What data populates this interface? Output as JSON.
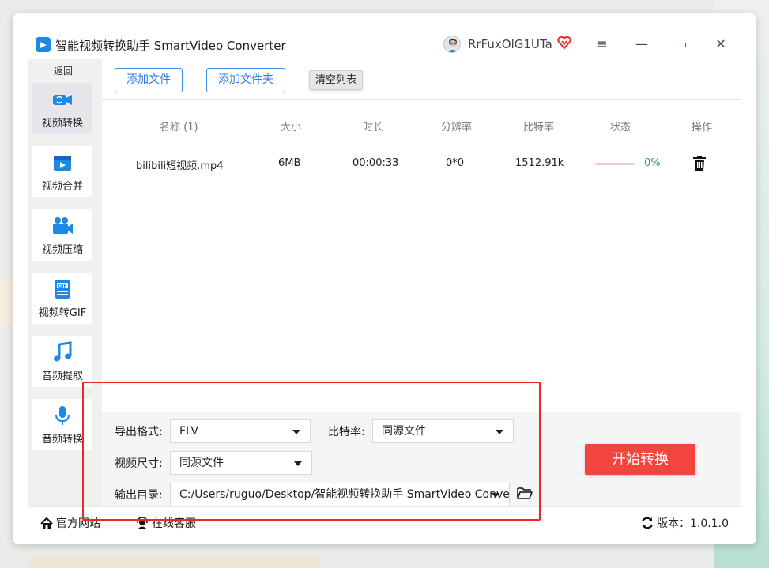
{
  "window": {
    "title": "智能视频转换助手 SmartVideo Converter",
    "logo_glyph": "▶",
    "user_name": "RrFuxOlG1UTa",
    "icons": [
      "app-logo-icon",
      "avatar-icon",
      "vip-heart-icon",
      "menu-icon",
      "minimize-icon",
      "maximize-icon",
      "close-icon"
    ],
    "controls": {
      "menu": "≡",
      "minimize": "—",
      "maximize": "▭",
      "close": "✕"
    }
  },
  "sidebar": {
    "back_label": "返回",
    "items": [
      {
        "label": "视频转换",
        "icon": "video-convert-icon",
        "active": true
      },
      {
        "label": "视频合并",
        "icon": "video-merge-icon",
        "active": false
      },
      {
        "label": "视频压缩",
        "icon": "video-compress-icon",
        "active": false
      },
      {
        "label": "视频转GIF",
        "icon": "gif-icon",
        "active": false
      },
      {
        "label": "音频提取",
        "icon": "music-note-icon",
        "active": false
      },
      {
        "label": "音频转换",
        "icon": "microphone-icon",
        "active": false
      }
    ],
    "accent_color": "#1e88e5"
  },
  "toolbar": {
    "add_file": "添加文件",
    "add_folder": "添加文件夹",
    "clear_list": "清空列表"
  },
  "file_table": {
    "columns": [
      "名称 (1)",
      "大小",
      "时长",
      "分辨率",
      "比特率",
      "状态",
      "操作"
    ],
    "rows": [
      {
        "name": "bilibili短视频.mp4",
        "size": "6MB",
        "duration": "00:00:33",
        "resolution": "0*0",
        "bitrate": "1512.91k",
        "progress": 0,
        "progress_text": "0%",
        "action_icon": "trash-icon"
      }
    ]
  },
  "settings": {
    "format_label": "导出格式:",
    "format_value": "FLV",
    "bitrate_label": "比特率:",
    "bitrate_value": "同源文件",
    "size_label": "视频尺寸:",
    "size_value": "同源文件",
    "output_label": "输出目录:",
    "output_value": "C:/Users/ruguo/Desktop/智能视频转换助手 SmartVideo Converter",
    "folder_icon": "folder-open-icon",
    "start_button": "开始转换",
    "start_color": "#f1453d"
  },
  "footer": {
    "website": "官方网站",
    "support": "在线客服",
    "version": "版本：1.0.1.0"
  },
  "annotation": {
    "color": "#e8282b"
  }
}
